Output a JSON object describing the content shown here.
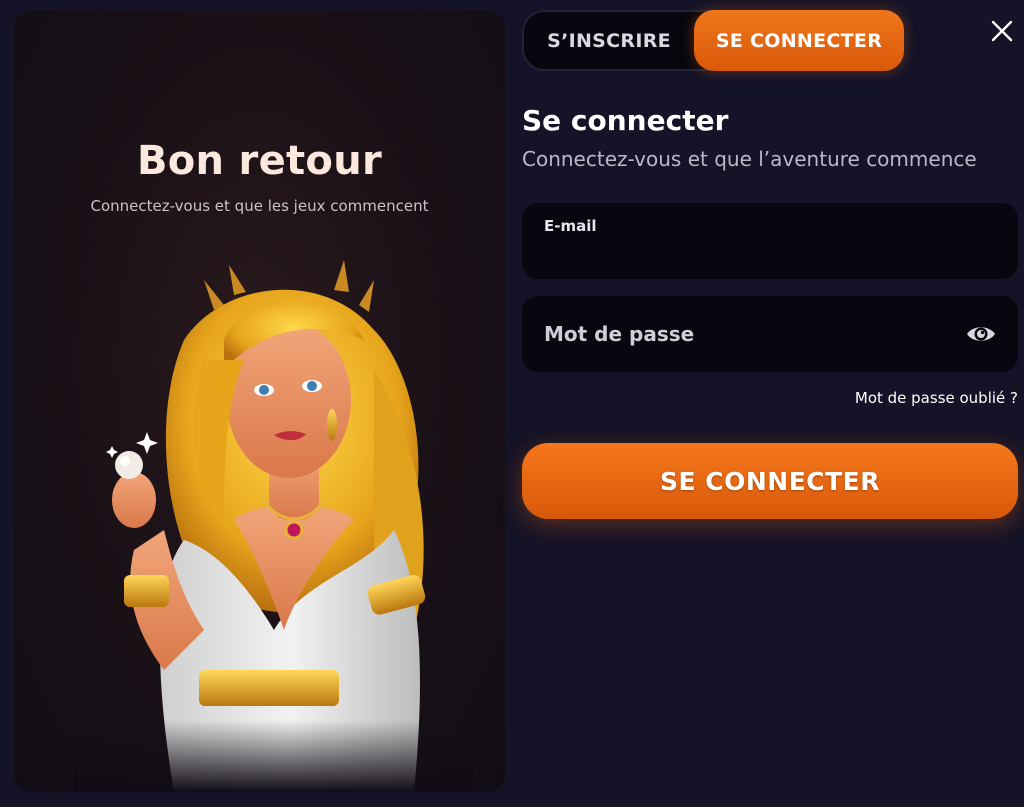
{
  "promo": {
    "title": "Bon retour",
    "subtitle": "Connectez-vous et que les jeux commencent",
    "image_icon": "goddess-illustration"
  },
  "tabs": {
    "register_label": "S’INSCRIRE",
    "login_label": "SE CONNECTER",
    "active": "login"
  },
  "close_icon": "close-icon",
  "form": {
    "title": "Se connecter",
    "subtitle": "Connectez-vous et que l’aventure commence",
    "email_label": "E-mail",
    "email_value": "",
    "password_placeholder": "Mot de passe",
    "password_value": "",
    "eye_icon": "eye-icon",
    "forgot_label": "Mot de passe oublié ?",
    "submit_label": "SE CONNECTER"
  },
  "colors": {
    "background": "#141327",
    "field_bg": "#07070f",
    "accent_orange": "#f0761c",
    "promo_bg": "#1c1218"
  }
}
